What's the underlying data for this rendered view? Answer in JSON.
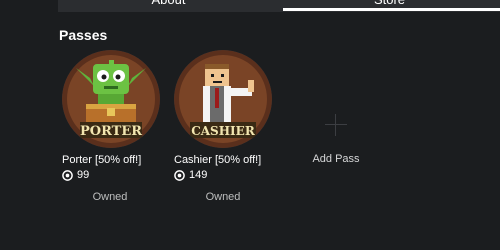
{
  "tabs": [
    {
      "label": "About"
    },
    {
      "label": "Store",
      "active": true
    }
  ],
  "section": {
    "title": "Passes"
  },
  "passes": [
    {
      "name": "Porter [50% off!]",
      "price": "99",
      "status": "Owned",
      "badge": "PORTER",
      "icon": "porter-goblin-thumbnail"
    },
    {
      "name": "Cashier [50% off!]",
      "price": "149",
      "status": "Owned",
      "badge": "CASHIER",
      "icon": "cashier-avatar-thumbnail"
    }
  ],
  "add_pass": {
    "label": "Add Pass",
    "icon": "plus-icon"
  },
  "colors": {
    "background": "#1b1d1f",
    "tab_bar": "#2b2d30",
    "text": "#ffffff",
    "muted": "#bdbebe",
    "badge_text": "#f2e6b0"
  }
}
